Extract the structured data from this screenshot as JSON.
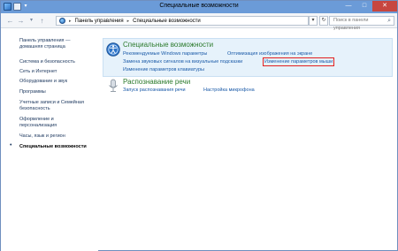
{
  "window": {
    "title": "Специальные возможности",
    "controls": {
      "minimize": "—",
      "maximize": "□",
      "close": "✕"
    }
  },
  "address": {
    "back": "←",
    "forward": "→",
    "up": "↑",
    "path": [
      "Панель управления",
      "Специальные возможности"
    ],
    "search_placeholder": "Поиск в панели управления"
  },
  "sidebar": {
    "home": "Панель управления — домашняя страница",
    "items": [
      {
        "label": "Система и безопасность"
      },
      {
        "label": "Сеть и Интернет"
      },
      {
        "label": "Оборудование и звук"
      },
      {
        "label": "Программы"
      },
      {
        "label": "Учетные записи и Семейная безопасность"
      },
      {
        "label": "Оформление и персонализация"
      },
      {
        "label": "Часы, язык и регион"
      },
      {
        "label": "Специальные возможности",
        "current": true
      }
    ]
  },
  "main": {
    "categories": [
      {
        "title": "Специальные возможности",
        "icon": "accessibility-icon",
        "links": [
          "Рекомендуемые Windows параметры",
          "Оптимизация изображения на экране",
          "Замена звуковых сигналов на визуальные подсказки",
          "Изменение параметров мыши",
          "Изменение параметров клавиатуры"
        ]
      },
      {
        "title": "Распознавание речи",
        "icon": "microphone-icon",
        "links": [
          "Запуск распознавания речи",
          "Настройка микрофона"
        ]
      }
    ]
  },
  "colors": {
    "titlebar": "#6b9bd8",
    "close": "#c7463f",
    "link": "#1a5aa8",
    "category": "#2b7a2b",
    "highlight": "#e21f1f"
  }
}
